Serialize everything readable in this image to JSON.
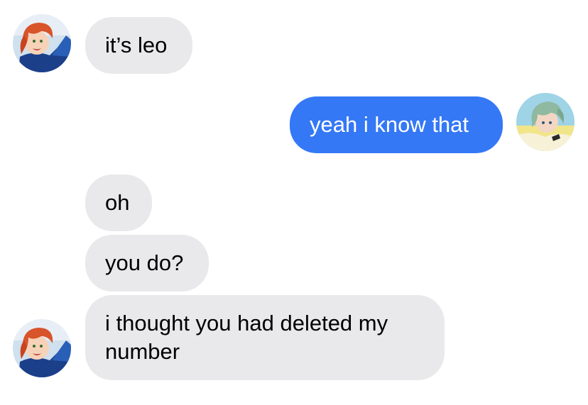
{
  "conversation": {
    "messages": [
      {
        "sender": "leo",
        "text": "it’s leo"
      },
      {
        "sender": "me",
        "text": "yeah i know that"
      },
      {
        "sender": "leo",
        "text": "oh"
      },
      {
        "sender": "leo",
        "text": "you do?"
      },
      {
        "sender": "leo",
        "text": "i thought you had deleted my number"
      }
    ]
  },
  "colors": {
    "incoming_bubble": "#e9e9eb",
    "outgoing_bubble": "#3478f6",
    "incoming_text": "#000000",
    "outgoing_text": "#ffffff"
  }
}
